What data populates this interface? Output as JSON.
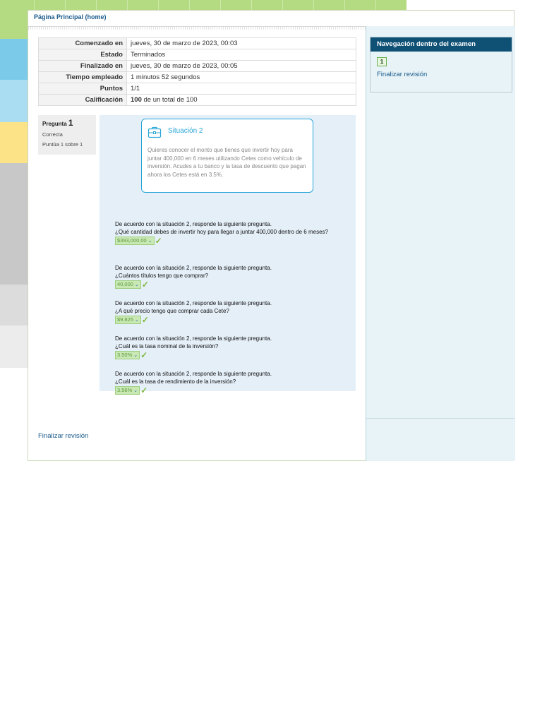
{
  "breadcrumb": "Página Principal (home)",
  "summary": [
    {
      "label": "Comenzado en",
      "value": "jueves, 30 de marzo de 2023, 00:03"
    },
    {
      "label": "Estado",
      "value": "Terminados"
    },
    {
      "label": "Finalizado en",
      "value": "jueves, 30 de marzo de 2023, 00:05"
    },
    {
      "label": "Tiempo empleado",
      "value": "1 minutos 52 segundos"
    },
    {
      "label": "Puntos",
      "value": "1/1"
    },
    {
      "label": "Calificación",
      "value_bold": "100",
      "value_rest": " de un total de 100"
    }
  ],
  "question": {
    "prefix": "Pregunta ",
    "number": "1",
    "state": "Correcta",
    "grade": "Puntúa 1 sobre 1"
  },
  "scenario": {
    "title": "Situación 2",
    "text": "Quieres conocer el monto que tienes que invertir hoy para juntar 400,000 en 6 meses utilizando Cetes como vehículo de inversión. Acudes a tu banco y la tasa de descuento que pagan ahora los Cetes está en 3.5%."
  },
  "subquestions": [
    {
      "intro": "De acuerdo con la situación 2, responde la siguiente pregunta.",
      "text": "¿Qué cantidad debes de invertir hoy para llegar a juntar 400,000 dentro de 6 meses?",
      "answer": "$393,000.00"
    },
    {
      "intro": "De acuerdo con la situación 2, responde la siguiente pregunta.",
      "text": "¿Cuántos títulos tengo que comprar?",
      "answer": "40,000"
    },
    {
      "intro": "De acuerdo con la situación 2, responde la siguiente pregunta.",
      "text": "¿A qué precio tengo que comprar cada Cete?",
      "answer": "$9.825"
    },
    {
      "intro": "De acuerdo con la situación 2, responde la siguiente pregunta.",
      "text": "¿Cuál es la tasa nominal de la inversión?",
      "answer": "3.50%"
    },
    {
      "intro": "De acuerdo con la situación 2, responde la siguiente pregunta.",
      "text": "¿Cuál es la tasa de rendimiento de la inversión?",
      "answer": "3.56%"
    }
  ],
  "finalize_label": "Finalizar revisión",
  "nav": {
    "title": "Navegación dentro del examen",
    "button": "1",
    "finalize": "Finalizar revisión"
  },
  "colors": {
    "nav_header": "#0f5075",
    "scenario_accent": "#29a6d9",
    "correct": "#7fb83c",
    "link": "#1a5a8a"
  }
}
